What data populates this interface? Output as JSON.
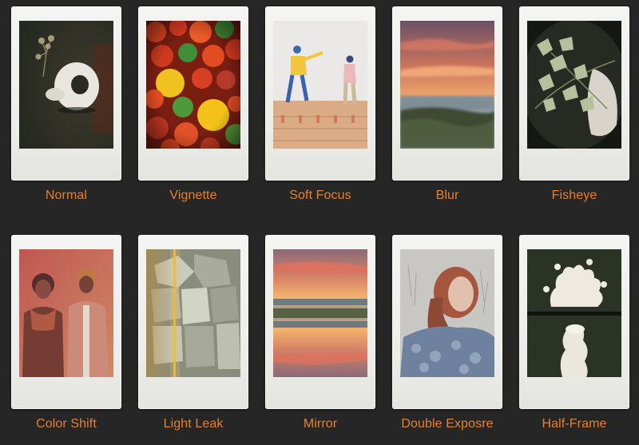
{
  "filters": [
    {
      "label": "Normal"
    },
    {
      "label": "Vignette"
    },
    {
      "label": "Soft Focus"
    },
    {
      "label": "Blur"
    },
    {
      "label": "Fisheye"
    },
    {
      "label": "Color Shift"
    },
    {
      "label": "Light Leak"
    },
    {
      "label": "Mirror"
    },
    {
      "label": "Double Exposre"
    },
    {
      "label": "Half-Frame"
    }
  ],
  "colors": {
    "background": "#262626",
    "label": "#e8802f",
    "frame": "#efefec"
  }
}
